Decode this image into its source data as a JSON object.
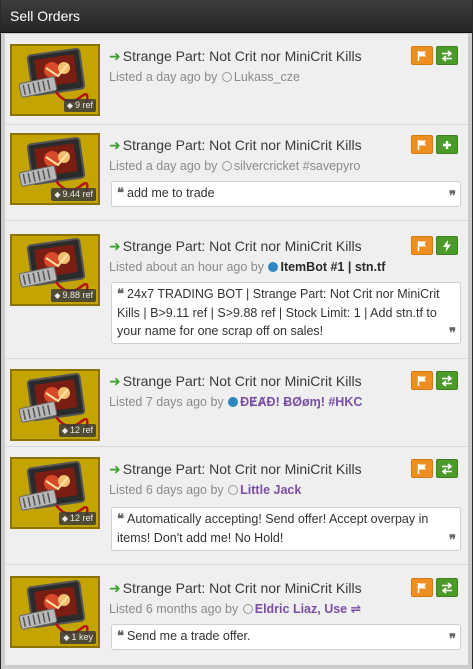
{
  "panel": {
    "title": "Sell Orders"
  },
  "orders": [
    {
      "item": "Strange Part: Not Crit nor MiniCrit Kills",
      "price": "9 ref",
      "listed": "Listed a day ago by",
      "user": "Lukass_cze",
      "user_style": "plain",
      "status": "offline",
      "action": "trade-offer",
      "comment": ""
    },
    {
      "item": "Strange Part: Not Crit nor MiniCrit Kills",
      "price": "9.44 ref",
      "listed": "Listed a day ago by",
      "user": "silvercricket #savepyro",
      "user_style": "plain",
      "status": "offline",
      "action": "add-friend",
      "comment": "add me to trade"
    },
    {
      "item": "Strange Part: Not Crit nor MiniCrit Kills",
      "price": "9.88 ref",
      "listed": "Listed about an hour ago by",
      "user": "ItemBot #1 | stn.tf",
      "user_style": "bot",
      "status": "online",
      "action": "instant-trade",
      "comment": "24x7 TRADING BOT | Strange Part: Not Crit nor MiniCrit Kills | B>9.11 ref | S>9.88 ref | Stock Limit: 1 | Add stn.tf to your name for one scrap off on sales!"
    },
    {
      "item": "Strange Part: Not Crit nor MiniCrit Kills",
      "price": "12 ref",
      "listed": "Listed 7 days ago by",
      "user": "ĐɆȺĐ! ɃØøɱ! #HKC",
      "user_style": "vip",
      "status": "online",
      "action": "trade-offer",
      "comment": ""
    },
    {
      "item": "Strange Part: Not Crit nor MiniCrit Kills",
      "price": "12 ref",
      "listed": "Listed 6 days ago by",
      "user": "Little Jack",
      "user_style": "vip",
      "status": "offline",
      "action": "trade-offer",
      "comment": "Automatically accepting! Send offer! Accept overpay in items! Don't add me! No Hold!"
    },
    {
      "item": "Strange Part: Not Crit nor MiniCrit Kills",
      "price": "1 key",
      "listed": "Listed 6 months ago by",
      "user": "Eldric Liaz, Use ⇌",
      "user_style": "vip",
      "status": "offline",
      "action": "trade-offer",
      "comment": "Send me a trade offer."
    }
  ],
  "colors": {
    "flag": "#ee8f22",
    "trade": "#4c9a2a",
    "arrow": "#3aa02e",
    "vip_name": "#7b4ea3",
    "online": "#2f86c0"
  },
  "icons": {
    "flag": "flag-icon",
    "trade-offer": "exchange-icon",
    "add-friend": "plus-icon",
    "instant-trade": "lightning-icon",
    "title-arrow": "arrow-right-icon",
    "price-tag": "tag-icon",
    "quote-open": "quote-open-icon",
    "quote-close": "quote-close-icon"
  }
}
